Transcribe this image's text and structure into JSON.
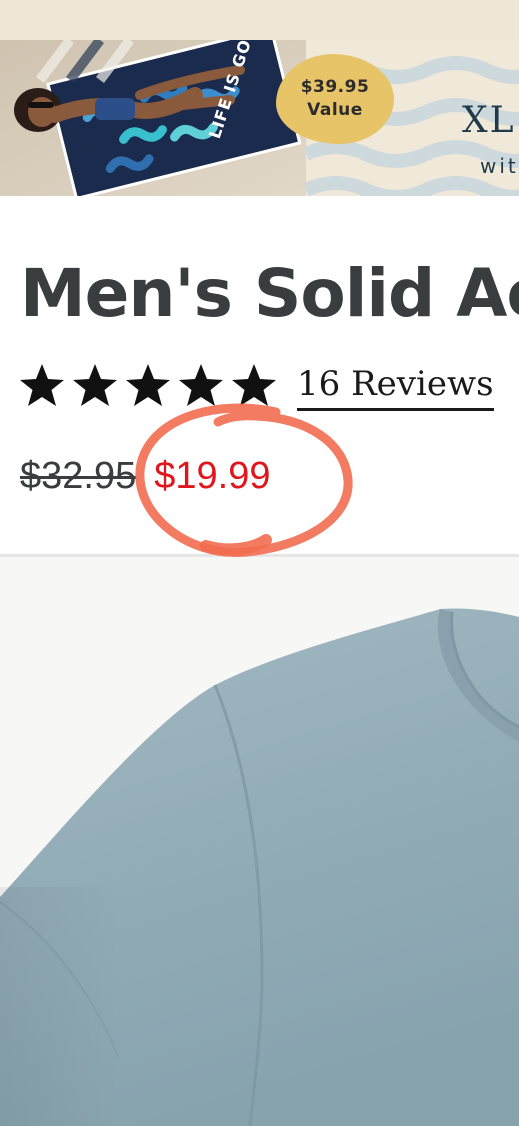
{
  "banner": {
    "value_badge_line1": "$39.95",
    "value_badge_line2": "Value",
    "headline": "XL",
    "subline": "wit",
    "towel_text": "LIFE IS GOOD"
  },
  "product": {
    "title": "Men's Solid Ac",
    "rating": 5,
    "rating_max": 5,
    "reviews_label": "16 Reviews",
    "price_original": "$32.95",
    "price_sale": "$19.99"
  },
  "colors": {
    "sale_price": "#e0161c",
    "title_text": "#3a3d3d",
    "annotation_circle": "#f26d50",
    "badge_yellow": "#e8c468",
    "shirt_heather_blue": "#93adb8",
    "banner_background": "#efe7d6"
  },
  "icons": {
    "star": "star-icon",
    "annotation": "hand-drawn-circle"
  }
}
